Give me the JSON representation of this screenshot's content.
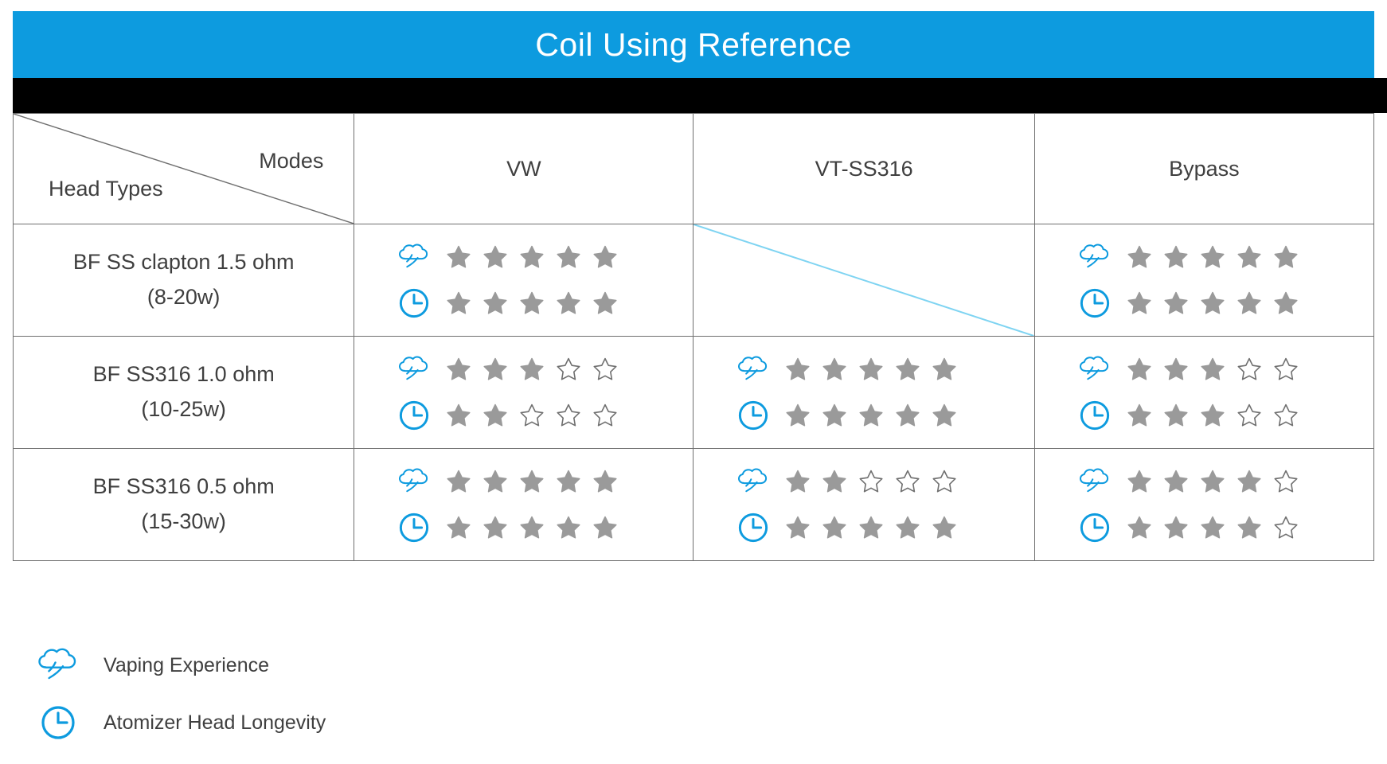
{
  "header": {
    "title": "Coil Using Reference",
    "accent_color": "#0d9bdf",
    "title_color": "#ffffff",
    "divider_color": "#000000"
  },
  "table": {
    "corner": {
      "columns_axis_label": "Modes",
      "rows_axis_label": "Head Types"
    },
    "mode_columns": [
      {
        "label": "VW"
      },
      {
        "label": "VT-SS316"
      },
      {
        "label": "Bypass"
      }
    ],
    "rows": [
      {
        "name": "BF SS clapton 1.5 ohm",
        "watts": "(8-20w)",
        "cells": [
          {
            "mode": "VW",
            "available": true,
            "vaping_experience": 5,
            "atomizer_head_longevity": 5
          },
          {
            "mode": "VT-SS316",
            "available": false,
            "vaping_experience": 0,
            "atomizer_head_longevity": 0
          },
          {
            "mode": "Bypass",
            "available": true,
            "vaping_experience": 5,
            "atomizer_head_longevity": 5
          }
        ]
      },
      {
        "name": "BF SS316 1.0 ohm",
        "watts": "(10-25w)",
        "cells": [
          {
            "mode": "VW",
            "available": true,
            "vaping_experience": 3,
            "atomizer_head_longevity": 2
          },
          {
            "mode": "VT-SS316",
            "available": true,
            "vaping_experience": 5,
            "atomizer_head_longevity": 5
          },
          {
            "mode": "Bypass",
            "available": true,
            "vaping_experience": 3,
            "atomizer_head_longevity": 3
          }
        ]
      },
      {
        "name": "BF SS316 0.5 ohm",
        "watts": "(15-30w)",
        "cells": [
          {
            "mode": "VW",
            "available": true,
            "vaping_experience": 5,
            "atomizer_head_longevity": 5
          },
          {
            "mode": "VT-SS316",
            "available": true,
            "vaping_experience": 2,
            "atomizer_head_longevity": 5
          },
          {
            "mode": "Bypass",
            "available": true,
            "vaping_experience": 4,
            "atomizer_head_longevity": 4
          }
        ]
      }
    ],
    "rating_max": 5,
    "star_filled_color": "#9a9a9a",
    "star_empty_color": "#ffffff",
    "star_outline_color": "#6f6f6f",
    "grid_line_color": "#6f6f6f",
    "strike_line_color": "#7fd4f2"
  },
  "legend": {
    "items": [
      {
        "icon": "vapor-cloud-icon",
        "label": "Vaping Experience"
      },
      {
        "icon": "clock-icon",
        "label": "Atomizer Head Longevity"
      }
    ],
    "icon_color": "#0d9bdf"
  }
}
